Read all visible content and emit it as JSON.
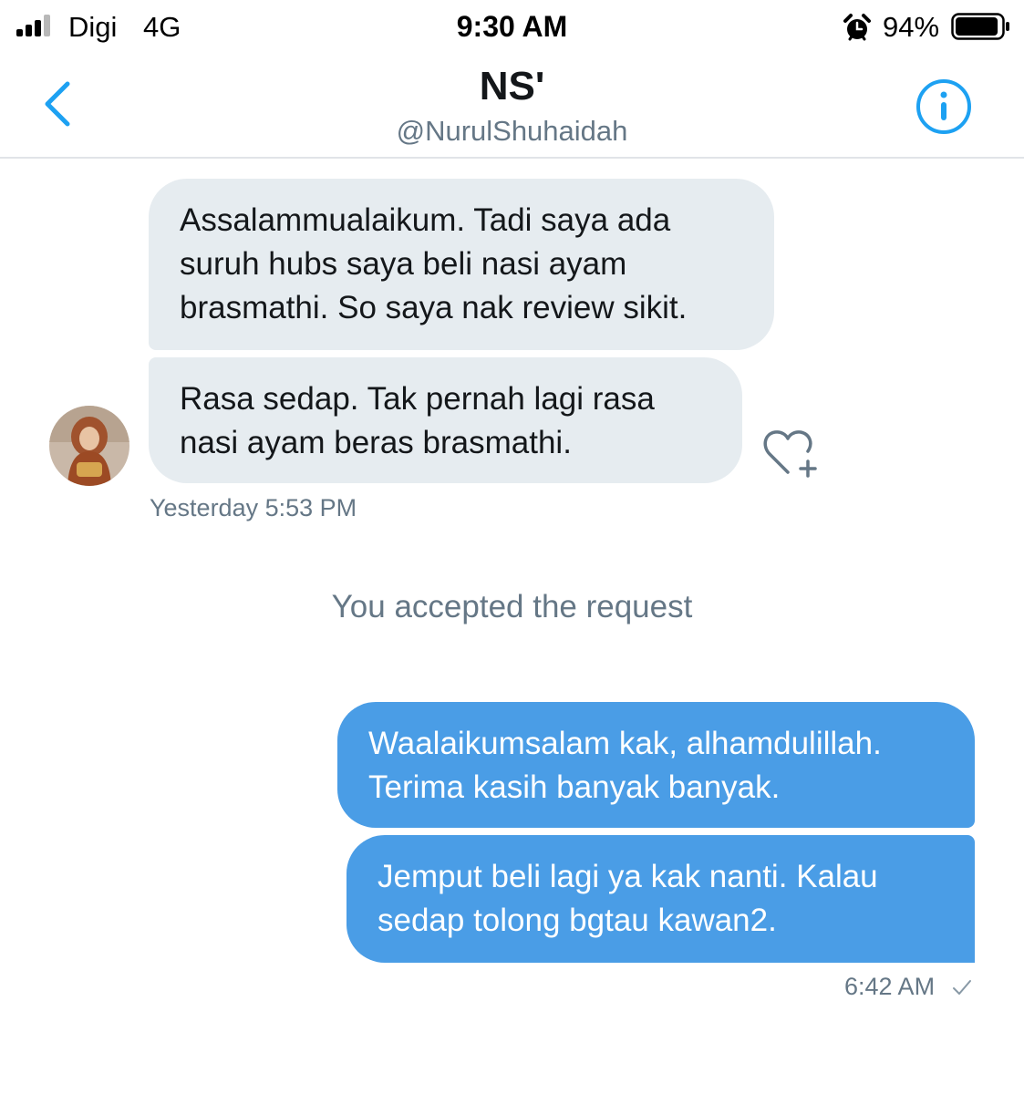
{
  "status_bar": {
    "carrier": "Digi",
    "network": "4G",
    "time": "9:30 AM",
    "battery_percent": "94%",
    "battery_level": 0.94,
    "signal_bars_active": 3,
    "signal_bars_total": 4
  },
  "header": {
    "back_icon": "chevron-left-icon",
    "name": "NS'",
    "handle": "@NurulShuhaidah",
    "info_icon": "info-circle-icon"
  },
  "conversation": {
    "received": [
      {
        "text": "Assalammualaikum. Tadi saya ada suruh hubs saya beli nasi ayam brasmathi. So saya nak review sikit."
      },
      {
        "text": "Rasa sedap. Tak pernah lagi rasa nasi ayam beras brasmathi."
      }
    ],
    "received_timestamp": "Yesterday 5:53 PM",
    "system_note": "You accepted the request",
    "sent": [
      {
        "text": "Waalaikumsalam kak, alhamdulillah. Terima kasih banyak banyak."
      },
      {
        "text": "Jemput beli lagi ya kak nanti. Kalau sedap tolong bgtau kawan2."
      }
    ],
    "sent_timestamp": "6:42 AM"
  },
  "colors": {
    "accent": "#1da1f2",
    "sent_bubble": "#4a9de6",
    "received_bubble": "#e6ecf0",
    "secondary_text": "#657786"
  }
}
